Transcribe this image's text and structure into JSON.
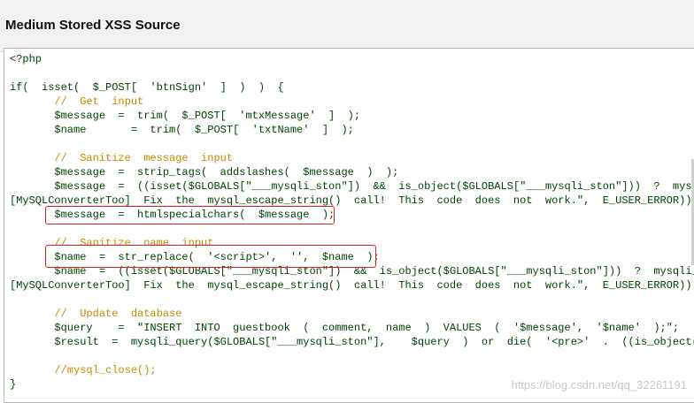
{
  "header": {
    "title": "Medium Stored XSS Source"
  },
  "code": {
    "lines": [
      {
        "text": "<?php",
        "type": "code"
      },
      {
        "text": "",
        "type": "code"
      },
      {
        "text": "if(  isset(  $_POST[  'btnSign'  ]  )  )  {",
        "type": "code"
      },
      {
        "text": "       //  Get  input",
        "type": "comment"
      },
      {
        "text": "       $message  =  trim(  $_POST[  'mtxMessage'  ]  );",
        "type": "code"
      },
      {
        "text": "       $name       =  trim(  $_POST[  'txtName'  ]  );",
        "type": "code"
      },
      {
        "text": "",
        "type": "code"
      },
      {
        "text": "       //  Sanitize  message  input",
        "type": "comment"
      },
      {
        "text": "       $message  =  strip_tags(  addslashes(  $message  )  );",
        "type": "code"
      },
      {
        "text": "       $message  =  ((isset($GLOBALS[\"___mysqli_ston\"])  &&  is_object($GLOBALS[\"___mysqli_ston\"]))  ?  mysqli_",
        "type": "code"
      },
      {
        "text": "[MySQLConverterToo]  Fix  the  mysql_escape_string()  call!  This  code  does  not  work.\",  E_USER_ERROR))  ?",
        "type": "code"
      },
      {
        "text": "       $message  =  htmlspecialchars(  $message  );",
        "type": "code"
      },
      {
        "text": "",
        "type": "code"
      },
      {
        "text": "       //  Sanitize  name  input",
        "type": "comment"
      },
      {
        "text": "       $name  =  str_replace(  '<script>',  '',  $name  );",
        "type": "code"
      },
      {
        "text": "       $name  =  ((isset($GLOBALS[\"___mysqli_ston\"])  &&  is_object($GLOBALS[\"___mysqli_ston\"]))  ?  mysqli_rea",
        "type": "code"
      },
      {
        "text": "[MySQLConverterToo]  Fix  the  mysql_escape_string()  call!  This  code  does  not  work.\",  E_USER_ERROR))  ?",
        "type": "code"
      },
      {
        "text": "",
        "type": "code"
      },
      {
        "text": "       //  Update  database",
        "type": "comment"
      },
      {
        "text": "       $query    =  \"INSERT  INTO  guestbook  (  comment,  name  )  VALUES  (  '$message',  '$name'  );\";",
        "type": "code"
      },
      {
        "text": "       $result  =  mysqli_query($GLOBALS[\"___mysqli_ston\"],    $query  )  or  die(  '<pre>'  .  ((is_object($GL",
        "type": "code"
      },
      {
        "text": "",
        "type": "code"
      },
      {
        "text": "       //mysql_close();",
        "type": "comment"
      },
      {
        "text": "}",
        "type": "code"
      }
    ]
  },
  "watermark": "https://blog.csdn.net/qq_32261191",
  "colors": {
    "code": "#004400",
    "comment": "#c78800",
    "highlight": "#e02020"
  }
}
